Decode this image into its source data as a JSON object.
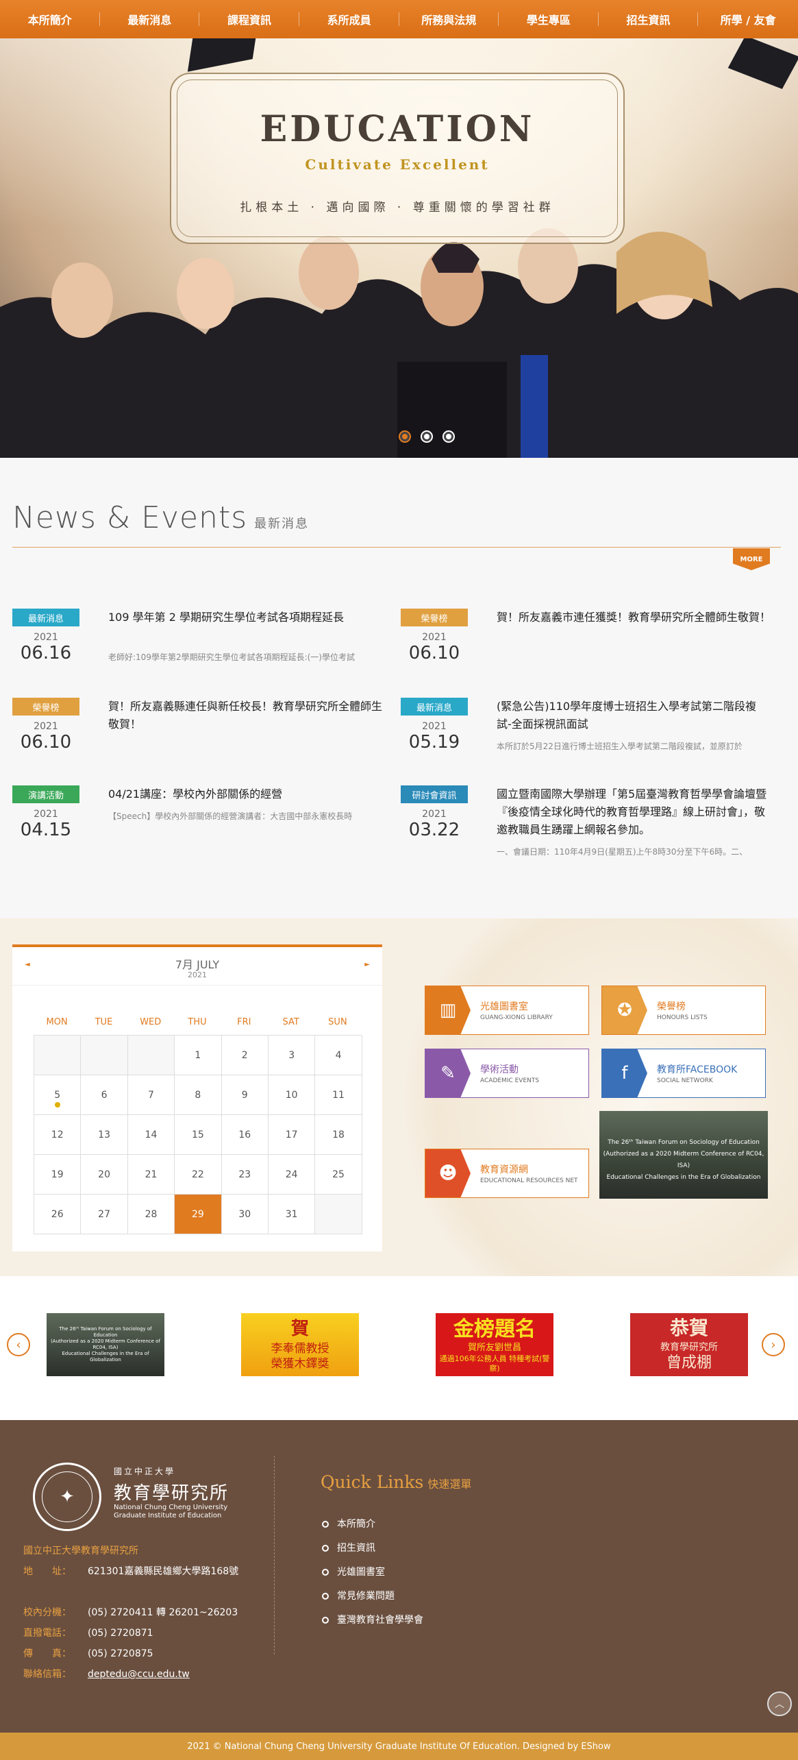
{
  "nav": [
    "本所簡介",
    "最新消息",
    "課程資訊",
    "系所成員",
    "所務與法規",
    "學生專區",
    "招生資訊",
    "所學 / 友會"
  ],
  "hero": {
    "title": "EDUCATION",
    "subtitle": "Cultivate Excellent",
    "motto": "扎根本土 · 邁向國際 · 尊重關懷的學習社群",
    "slides": 3,
    "active_slide": 1
  },
  "news": {
    "title": "News & Events",
    "title_zh": "最新消息",
    "more": "MORE",
    "items": [
      {
        "tag": "最新消息",
        "color": "#2aa8c8",
        "year": "2021",
        "date": "06.16",
        "title": "109 學年第 2 學期研究生學位考試各項期程延長",
        "summary": "老師好:109學年第2學期研究生學位考試各項期程延長:(一)學位考試"
      },
      {
        "tag": "榮譽榜",
        "color": "#e0a040",
        "year": "2021",
        "date": "06.10",
        "title": "賀！所友嘉義市連任獲獎！教育學研究所全體師生敬賀！",
        "summary": ""
      },
      {
        "tag": "榮譽榜",
        "color": "#e0a040",
        "year": "2021",
        "date": "06.10",
        "title": "賀！所友嘉義縣連任與新任校長！教育學研究所全體師生 敬賀！",
        "summary": ""
      },
      {
        "tag": "最新消息",
        "color": "#2aa8c8",
        "year": "2021",
        "date": "05.19",
        "title": "(緊急公告)110學年度博士班招生入學考試第二階段複試-全面採視訊面試",
        "summary": "本所訂於5月22日進行博士班招生入學考試第二階段複試，並原訂於"
      },
      {
        "tag": "演講活動",
        "color": "#3aa858",
        "year": "2021",
        "date": "04.15",
        "title": "04/21講座：學校內外部關係的經營",
        "summary": "【Speech】學校內外部關係的經營演講者：大吉國中部永憲校長時"
      },
      {
        "tag": "研討會資訊",
        "color": "#2a8ab8",
        "year": "2021",
        "date": "03.22",
        "title": "國立暨南國際大學辦理「第5屆臺灣教育哲學學會論壇暨『後疫情全球化時代的教育哲學理路』線上研討會」，敬邀教職員生踴躍上網報名參加。",
        "summary": "一、會議日期：110年4月9日(星期五)上午8時30分至下午6時。二、"
      }
    ]
  },
  "calendar": {
    "month": "7月 JULY",
    "year": "2021",
    "prev": "◄",
    "next": "►",
    "weekdays": [
      "MON",
      "TUE",
      "WED",
      "THU",
      "FRI",
      "SAT",
      "SUN"
    ],
    "leading_blanks": 3,
    "days": 31,
    "today": 29,
    "event_days": [
      5
    ]
  },
  "quick_boxes": [
    {
      "t1": "光雄圖書室",
      "t2": "GUANG-XIONG LIBRARY",
      "icon": "library-icon",
      "glyph": "▥",
      "color": "#e07b20",
      "style": ""
    },
    {
      "t1": "榮譽榜",
      "t2": "HONOURS LISTS",
      "icon": "medal-icon",
      "glyph": "✪",
      "color": "#e8a040",
      "style": ""
    },
    {
      "t1": "學術活動",
      "t2": "ACADEMIC EVENTS",
      "icon": "document-icon",
      "glyph": "✎",
      "color": "#8a5aa8",
      "style": "purple"
    },
    {
      "t1": "教育所FACEBOOK",
      "t2": "SOCIAL NETWORK",
      "icon": "facebook-icon",
      "glyph": "f",
      "color": "#3a70b8",
      "style": "blue"
    },
    {
      "t1": "教育資源網",
      "t2": "EDUCATIONAL RESOURCES NET",
      "icon": "people-icon",
      "glyph": "☻",
      "color": "#e05028",
      "style": ""
    }
  ],
  "forum": {
    "l1": "The 26ᵗʰ Taiwan Forum on Sociology of Education",
    "l2": "(Authorized as a 2020 Midterm Conference of RC04, ISA)",
    "l3": "Educational Challenges in the Era of Globalization"
  },
  "carousel": {
    "prev": "‹",
    "next": "›",
    "items": [
      {
        "l1": "The 26ᵗʰ Taiwan Forum on Sociology of Education",
        "l2": "(Authorized as a 2020 Midterm Conference of RC04, ISA)",
        "l3": "Educational Challenges in the Era of Globalization"
      },
      {
        "l1": "賀",
        "l2": "李奉儒教授",
        "l3": "榮獲木鐸獎"
      },
      {
        "l1": "金榜題名",
        "l2": "賀所友劉世昌",
        "l3": "通過106年公務人員 特種考試(警察)"
      },
      {
        "l1": "恭賀",
        "l2": "教育學研究所",
        "l3": "曾成棚"
      }
    ]
  },
  "footer": {
    "logo_t1": "國立中正大學",
    "logo_t2": "教育學研究所",
    "logo_t3a": "National Chung Cheng University",
    "logo_t3b": "Graduate Institute of Education",
    "org": "國立中正大學教育學研究所",
    "address_label": "地　　址：",
    "address": "621301嘉義縣民雄鄉大學路168號",
    "ext_label": "校內分機：",
    "ext": "(05) 2720411 轉 26201~26203",
    "phone_label": "直撥電話：",
    "phone": "(05) 2720871",
    "fax_label": "傳　　真：",
    "fax": "(05) 2720875",
    "email_label": "聯絡信箱：",
    "email": "deptedu@ccu.edu.tw",
    "ql_title": "Quick Links",
    "ql_title_zh": "快速選單",
    "links": [
      "本所簡介",
      "招生資訊",
      "光雄圖書室",
      "常見修業問題",
      "臺灣教育社會學學會"
    ],
    "copyright": "2021 © National Chung Cheng University Graduate Institute Of Education. Designed by EShow"
  }
}
